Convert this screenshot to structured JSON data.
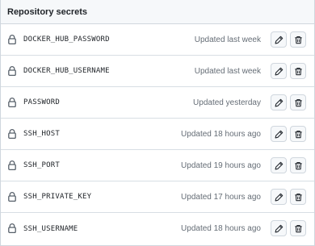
{
  "header": {
    "title": "Repository secrets"
  },
  "secrets": [
    {
      "name": "DOCKER_HUB_PASSWORD",
      "updated": "Updated last week"
    },
    {
      "name": "DOCKER_HUB_USERNAME",
      "updated": "Updated last week"
    },
    {
      "name": "PASSWORD",
      "updated": "Updated yesterday"
    },
    {
      "name": "SSH_HOST",
      "updated": "Updated 18 hours ago"
    },
    {
      "name": "SSH_PORT",
      "updated": "Updated 19 hours ago"
    },
    {
      "name": "SSH_PRIVATE_KEY",
      "updated": "Updated 17 hours ago"
    },
    {
      "name": "SSH_USERNAME",
      "updated": "Updated 18 hours ago"
    }
  ],
  "icons": {
    "row": "lock-icon",
    "edit": "pencil-icon",
    "delete": "trash-icon"
  }
}
